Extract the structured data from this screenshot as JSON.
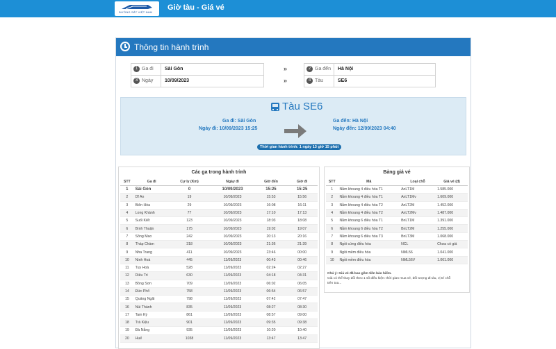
{
  "header": {
    "logo_text": "ĐƯỜNG SẮT VIỆT NAM",
    "app_title": "Giờ tàu - Giá vé"
  },
  "panel": {
    "title": "Thông tin hành trình"
  },
  "form": {
    "from": {
      "num": "1",
      "label": "Ga đi",
      "value": "Sài Gòn"
    },
    "to": {
      "num": "2",
      "label": "Ga đến",
      "value": "Hà Nội"
    },
    "date": {
      "num": "3",
      "label": "Ngày",
      "value": "10/09/2023"
    },
    "train": {
      "num": "4",
      "label": "Tàu",
      "value": "SE6"
    },
    "arrow": "»"
  },
  "trip": {
    "train_label": "Tàu SE6",
    "depart_station": "Ga đi: Sài Gòn",
    "depart_date": "Ngày đi: 10/09/2023 15:25",
    "arrive_station": "Ga đến: Hà Nội",
    "arrive_date": "Ngày đến: 12/09/2023 04:40",
    "duration": "Thời gian hành trình: 1 ngày 13 giờ 15 phút"
  },
  "stations": {
    "title": "Các ga trong hành trình",
    "headers": [
      "STT",
      "Ga đi",
      "Cự ly (Km)",
      "Ngày đi",
      "Giờ đến",
      "Giờ đi"
    ],
    "rows": [
      [
        "1",
        "Sài Gòn",
        "0",
        "10/09/2023",
        "15:25",
        "15:25"
      ],
      [
        "2",
        "Dĩ An",
        "19",
        "10/09/2023",
        "15:53",
        "15:56"
      ],
      [
        "3",
        "Biên Hòa",
        "29",
        "10/09/2023",
        "16:08",
        "16:11"
      ],
      [
        "4",
        "Long Khánh",
        "77",
        "10/09/2023",
        "17:10",
        "17:13"
      ],
      [
        "5",
        "Suối Kiết",
        "123",
        "10/09/2023",
        "18:03",
        "18:08"
      ],
      [
        "6",
        "Bình Thuận",
        "175",
        "10/09/2023",
        "19:02",
        "19:07"
      ],
      [
        "7",
        "Sông Mao",
        "242",
        "10/09/2023",
        "20:13",
        "20:16"
      ],
      [
        "8",
        "Tháp Chàm",
        "318",
        "10/09/2023",
        "21:36",
        "21:39"
      ],
      [
        "9",
        "Nha Trang",
        "411",
        "10/09/2023",
        "23:46",
        "00:00"
      ],
      [
        "10",
        "Ninh Hoà",
        "445",
        "11/09/2023",
        "00:43",
        "00:46"
      ],
      [
        "11",
        "Tuy Hoà",
        "528",
        "11/09/2023",
        "02:24",
        "02:27"
      ],
      [
        "12",
        "Diêu Trì",
        "630",
        "11/09/2023",
        "04:18",
        "04:31"
      ],
      [
        "13",
        "Bồng Sơn",
        "709",
        "11/09/2023",
        "06:02",
        "06:05"
      ],
      [
        "14",
        "Đức Phổ",
        "758",
        "11/09/2023",
        "06:54",
        "06:57"
      ],
      [
        "15",
        "Quảng Ngãi",
        "798",
        "11/09/2023",
        "07:42",
        "07:47"
      ],
      [
        "16",
        "Núi Thành",
        "835",
        "11/09/2023",
        "08:27",
        "08:30"
      ],
      [
        "17",
        "Tam Kỳ",
        "861",
        "11/09/2023",
        "08:57",
        "09:00"
      ],
      [
        "18",
        "Trà Kiệu",
        "901",
        "11/09/2023",
        "09:35",
        "09:38"
      ],
      [
        "19",
        "Đà Nẵng",
        "935",
        "11/09/2023",
        "10:20",
        "10:40"
      ],
      [
        "20",
        "Huế",
        "1038",
        "11/09/2023",
        "13:47",
        "13:47"
      ]
    ]
  },
  "fares": {
    "title": "Bảng giá vé",
    "headers": [
      "STT",
      "Mã",
      "Loại chỗ",
      "Giá vé (đ)"
    ],
    "rows": [
      [
        "1",
        "Nằm khoang 4 điều hòa T1",
        "AnLT1M",
        "1.585.000"
      ],
      [
        "2",
        "Nằm khoang 4 điều hòa T1",
        "AnLT1Mv",
        "1.609.000"
      ],
      [
        "3",
        "Nằm khoang 4 điều hòa T2",
        "AnLT2M",
        "1.452.000"
      ],
      [
        "4",
        "Nằm khoang 4 điều hòa T2",
        "AnLT2Mv",
        "1.487.000"
      ],
      [
        "5",
        "Nằm khoang 6 điều hòa T1",
        "BnLT1M",
        "1.391.000"
      ],
      [
        "6",
        "Nằm khoang 6 điều hòa T2",
        "BnLT2M",
        "1.255.000"
      ],
      [
        "7",
        "Nằm khoang 6 điều hòa T3",
        "BnLT3M",
        "1.068.000"
      ],
      [
        "8",
        "Ngồi cứng điều hòa",
        "NCL",
        "Chưa có giá"
      ],
      [
        "9",
        "Ngồi mềm điều hòa",
        "NML56",
        "1.041.000"
      ],
      [
        "10",
        "Ngồi mềm điều hòa",
        "NML56V",
        "1.061.000"
      ]
    ],
    "note_title": "Chú ý: Giá vé đã bao gồm tiền bảo hiểm.",
    "note_1": "Giá có thể thay đổi theo 1 số điều kiện: thời gian mua vé, đối tượng đi tàu, vị trí chỗ",
    "note_2": "trên toa..."
  }
}
